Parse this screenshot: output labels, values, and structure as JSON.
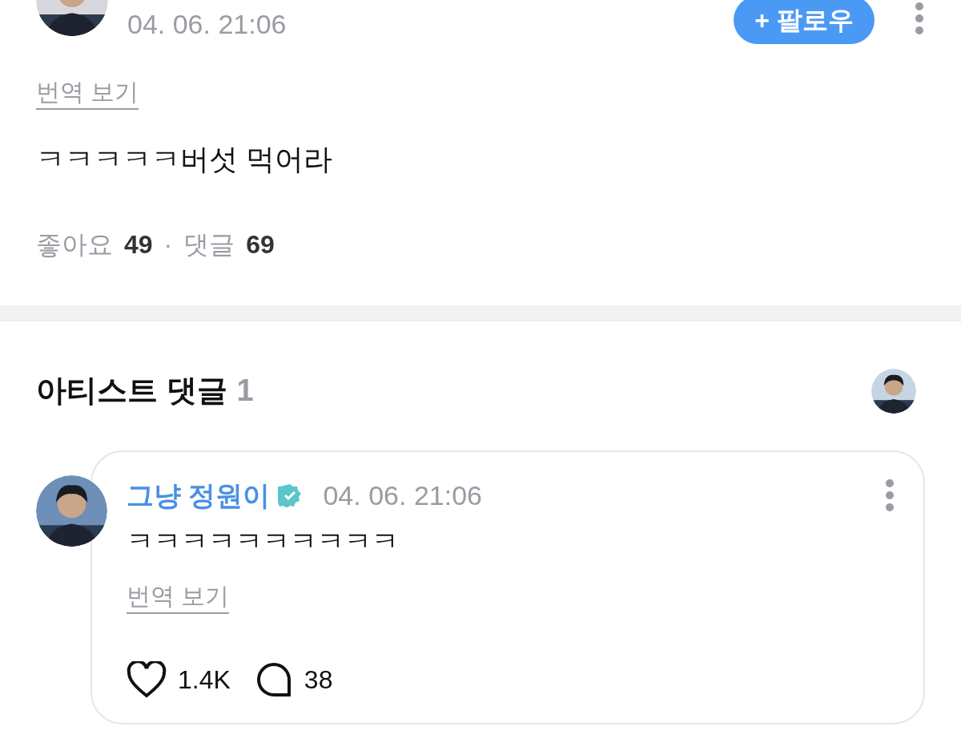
{
  "post": {
    "date": "04. 06. 21:06",
    "follow_button": "+ 팔로우",
    "translate_link": "번역 보기",
    "text": "ㅋㅋㅋㅋㅋ버섯 먹어라",
    "likes_label": "좋아요",
    "likes": "49",
    "separator": "·",
    "comments_label": "댓글",
    "comments": "69"
  },
  "artist_comments": {
    "title": "아티스트 댓글",
    "count": "1",
    "comments": [
      {
        "author": "그냥 정원이",
        "verified": true,
        "date": "04. 06. 21:06",
        "text": "ㅋㅋㅋㅋㅋㅋㅋㅋㅋㅋ",
        "translate_link": "번역 보기",
        "likes": "1.4K",
        "replies": "38"
      }
    ]
  }
}
